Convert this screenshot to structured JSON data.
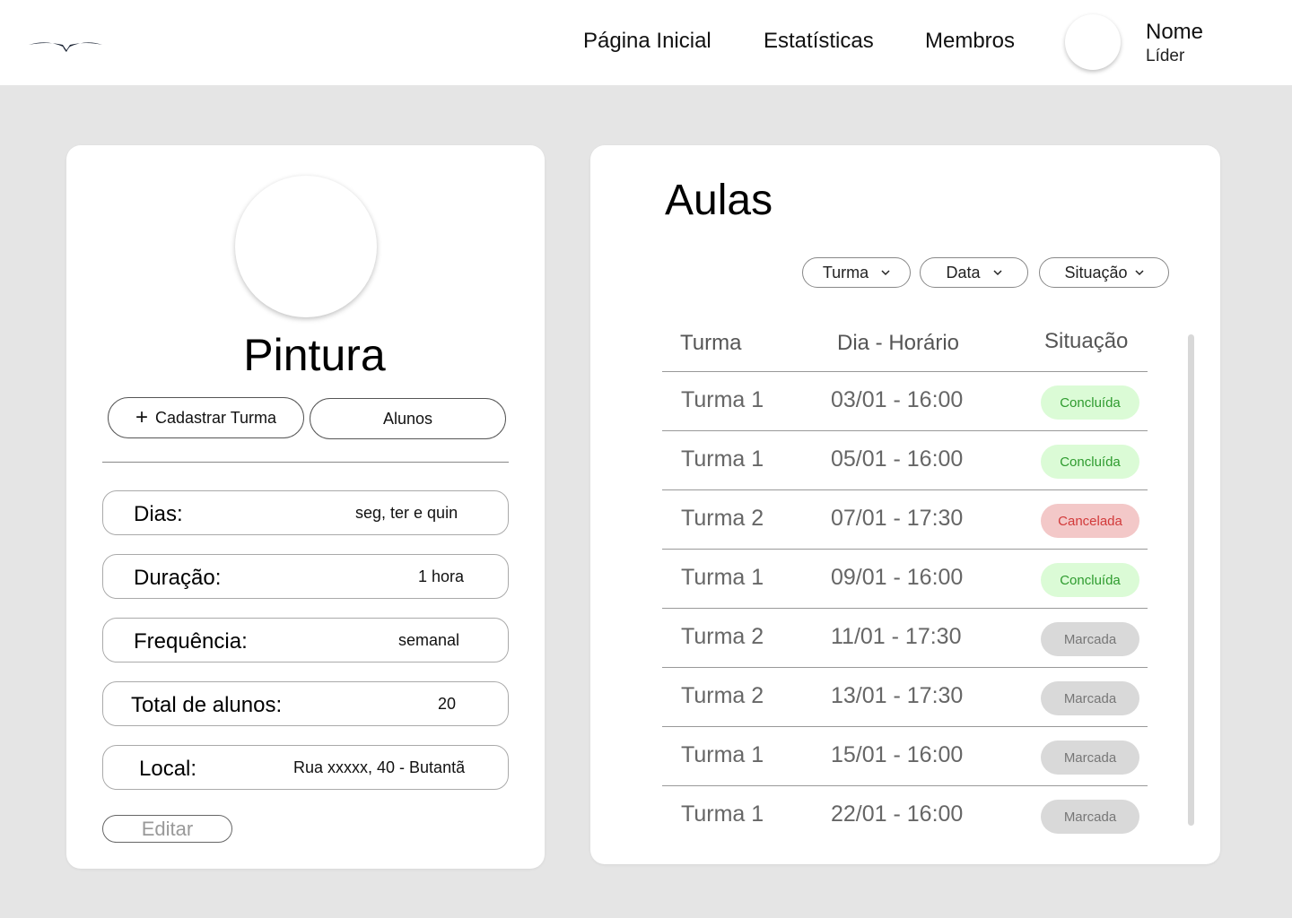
{
  "colors": {
    "page_bg": "#e5e5e5",
    "card_bg": "#ffffff",
    "status_concluida_bg": "#dbfbd6",
    "status_concluida_text": "#2e9b2e",
    "status_cancelada_bg": "#f3c8c8",
    "status_cancelada_text": "#d23a3a",
    "status_marcada_bg": "#d9d9d9",
    "status_marcada_text": "#777777"
  },
  "header": {
    "logo_icon": "bird-logo-icon",
    "nav": [
      "Página Inicial",
      "Estatísticas",
      "Membros"
    ],
    "user": {
      "name": "Nome",
      "role": "Líder"
    }
  },
  "course": {
    "title": "Pintura",
    "buttons": {
      "register": "Cadastrar Turma",
      "students": "Alunos",
      "edit": "Editar"
    },
    "info": [
      {
        "label": "Dias:",
        "value": "seg, ter e quin"
      },
      {
        "label": "Duração:",
        "value": "1 hora"
      },
      {
        "label": "Frequência:",
        "value": "semanal"
      },
      {
        "label": "Total de alunos:",
        "value": "20"
      },
      {
        "label": "Local:",
        "value": "Rua xxxxx, 40 - Butantã"
      }
    ]
  },
  "aulas": {
    "title": "Aulas",
    "filters": [
      "Turma",
      "Data",
      "Situação"
    ],
    "columns": [
      "Turma",
      "Dia - Horário",
      "Situação"
    ],
    "rows": [
      {
        "turma": "Turma 1",
        "datetime": "03/01 - 16:00",
        "status": "Concluída",
        "kind": "concluida"
      },
      {
        "turma": "Turma 1",
        "datetime": "05/01 - 16:00",
        "status": "Concluída",
        "kind": "concluida"
      },
      {
        "turma": "Turma 2",
        "datetime": "07/01 - 17:30",
        "status": "Cancelada",
        "kind": "cancelada"
      },
      {
        "turma": "Turma 1",
        "datetime": "09/01 - 16:00",
        "status": "Concluída",
        "kind": "concluida"
      },
      {
        "turma": "Turma 2",
        "datetime": "11/01 - 17:30",
        "status": "Marcada",
        "kind": "marcada"
      },
      {
        "turma": "Turma 2",
        "datetime": "13/01 - 17:30",
        "status": "Marcada",
        "kind": "marcada"
      },
      {
        "turma": "Turma 1",
        "datetime": "15/01 - 16:00",
        "status": "Marcada",
        "kind": "marcada"
      },
      {
        "turma": "Turma 1",
        "datetime": "22/01 - 16:00",
        "status": "Marcada",
        "kind": "marcada"
      }
    ]
  }
}
